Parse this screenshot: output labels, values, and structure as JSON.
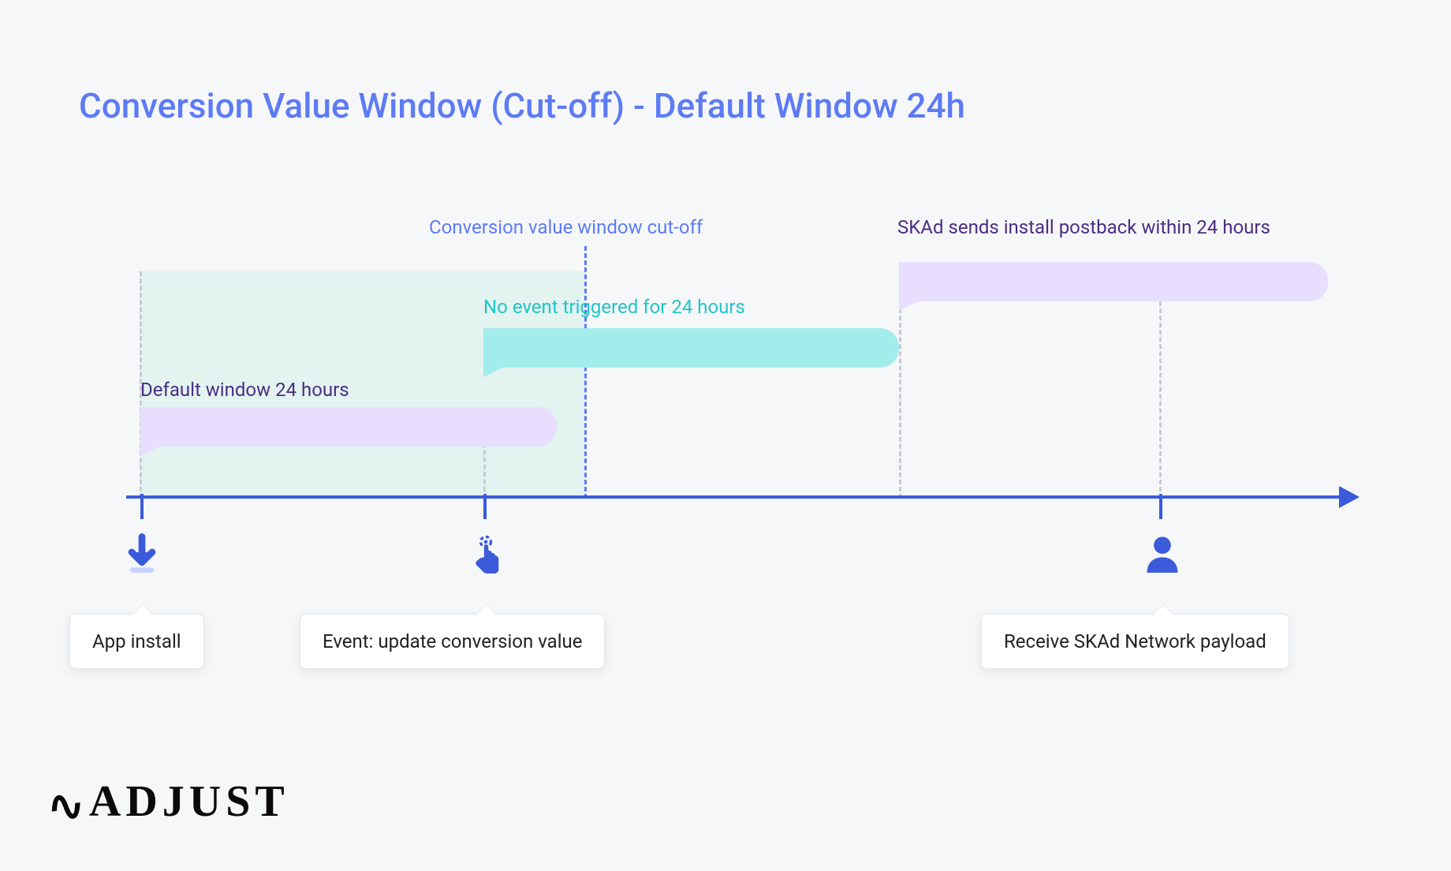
{
  "title": "Conversion Value Window (Cut-off) - Default Window 24h",
  "annotations": {
    "cutoff": "Conversion value window cut-off",
    "postback": "SKAd sends install postback within 24 hours",
    "noevent": "No event triggered for 24 hours",
    "default_window": "Default window 24 hours"
  },
  "timeline_events": {
    "install": "App install",
    "update": "Event: update conversion value",
    "receive": "Receive SKAd Network payload"
  },
  "brand": "ADJUST",
  "colors": {
    "heading_blue": "#5d7bf5",
    "axis_blue": "#3b5bdb",
    "bubble_purple": "#e8deff",
    "bubble_cyan": "#a3ecec",
    "text_purple": "#4b2e83",
    "text_cyan": "#1fc6c6"
  }
}
